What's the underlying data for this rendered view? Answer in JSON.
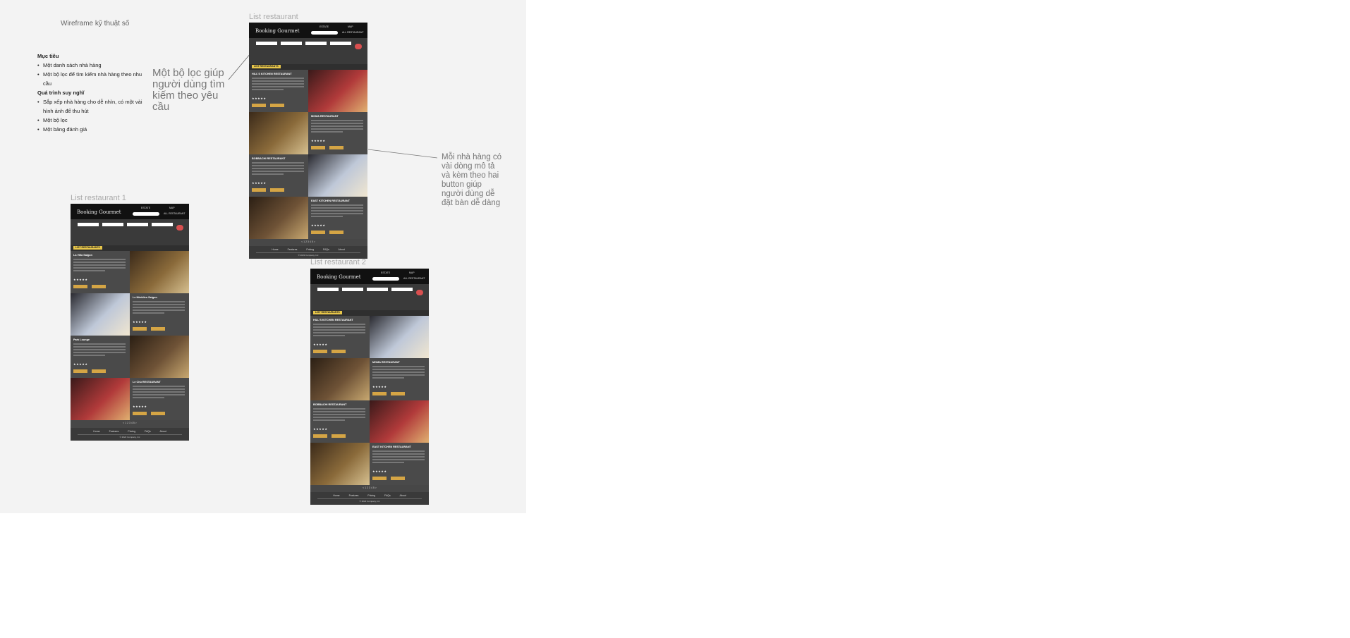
{
  "canvas": {
    "title": "Wireframe kỹ thuật số"
  },
  "notes": {
    "heading1": "Mục tiêu",
    "goals": [
      "Một danh sách nhà hàng",
      "Một bộ lọc để tìm kiếm nhà hàng theo nhu cầu"
    ],
    "heading2": "Quá trình suy nghĩ",
    "thoughts": [
      "Sắp xếp nhà hàng cho dễ nhìn, có một vài hình ảnh để thu hút",
      "Một bộ lọc",
      "Một bảng đánh giá"
    ]
  },
  "frames": [
    {
      "label": "List restaurant",
      "restaurants": [
        "HILL'S KITCHEN RESTAURANT",
        "MOMA RESTAURANT",
        "BOBBACHI RESTAURANT",
        "EAST KITCHEN RESTAURANT"
      ]
    },
    {
      "label": "List restaurant 1",
      "restaurants": [
        "La Villa Saigon",
        "Le Méridien Saigon",
        "Park Lounge",
        "Le Chù RESTAURANT"
      ]
    },
    {
      "label": "List restaurant 2",
      "restaurants": [
        "HILL'S KITCHEN RESTAURANT",
        "MOMA RESTAURANT",
        "BOBBACHI RESTAURANT",
        "EAST KITCHEN RESTAURANT"
      ]
    }
  ],
  "mock": {
    "brand": "Booking Gourmet",
    "nav_top1": "ESTATE",
    "nav_top2": "MAP",
    "all_restaurant": "ALL RESTAURANT",
    "section_label": "LIST RESTAURANTS",
    "stars": "★★★★★",
    "pager": "< 1 2 3 4 5 >",
    "footer_nav": "Home Features Pricing FAQs About",
    "copyright": "© 2022 Company, Inc"
  },
  "annotations": {
    "filter_note": "Một bộ lọc giúp người dùng tìm kiếm theo yêu cầu",
    "item_note": "Mỗi nhà hàng có vài dòng mô tả và kèm theo hai button giúp người dùng dễ đặt bàn dễ dàng"
  },
  "colors": {
    "canvas_bg": "#f3f3f3",
    "mock_bg": "#474747",
    "header_bg": "#111111",
    "accent_yellow": "#e7c64a",
    "button_gold": "#d5a545",
    "filter_red": "#d94f4f"
  }
}
